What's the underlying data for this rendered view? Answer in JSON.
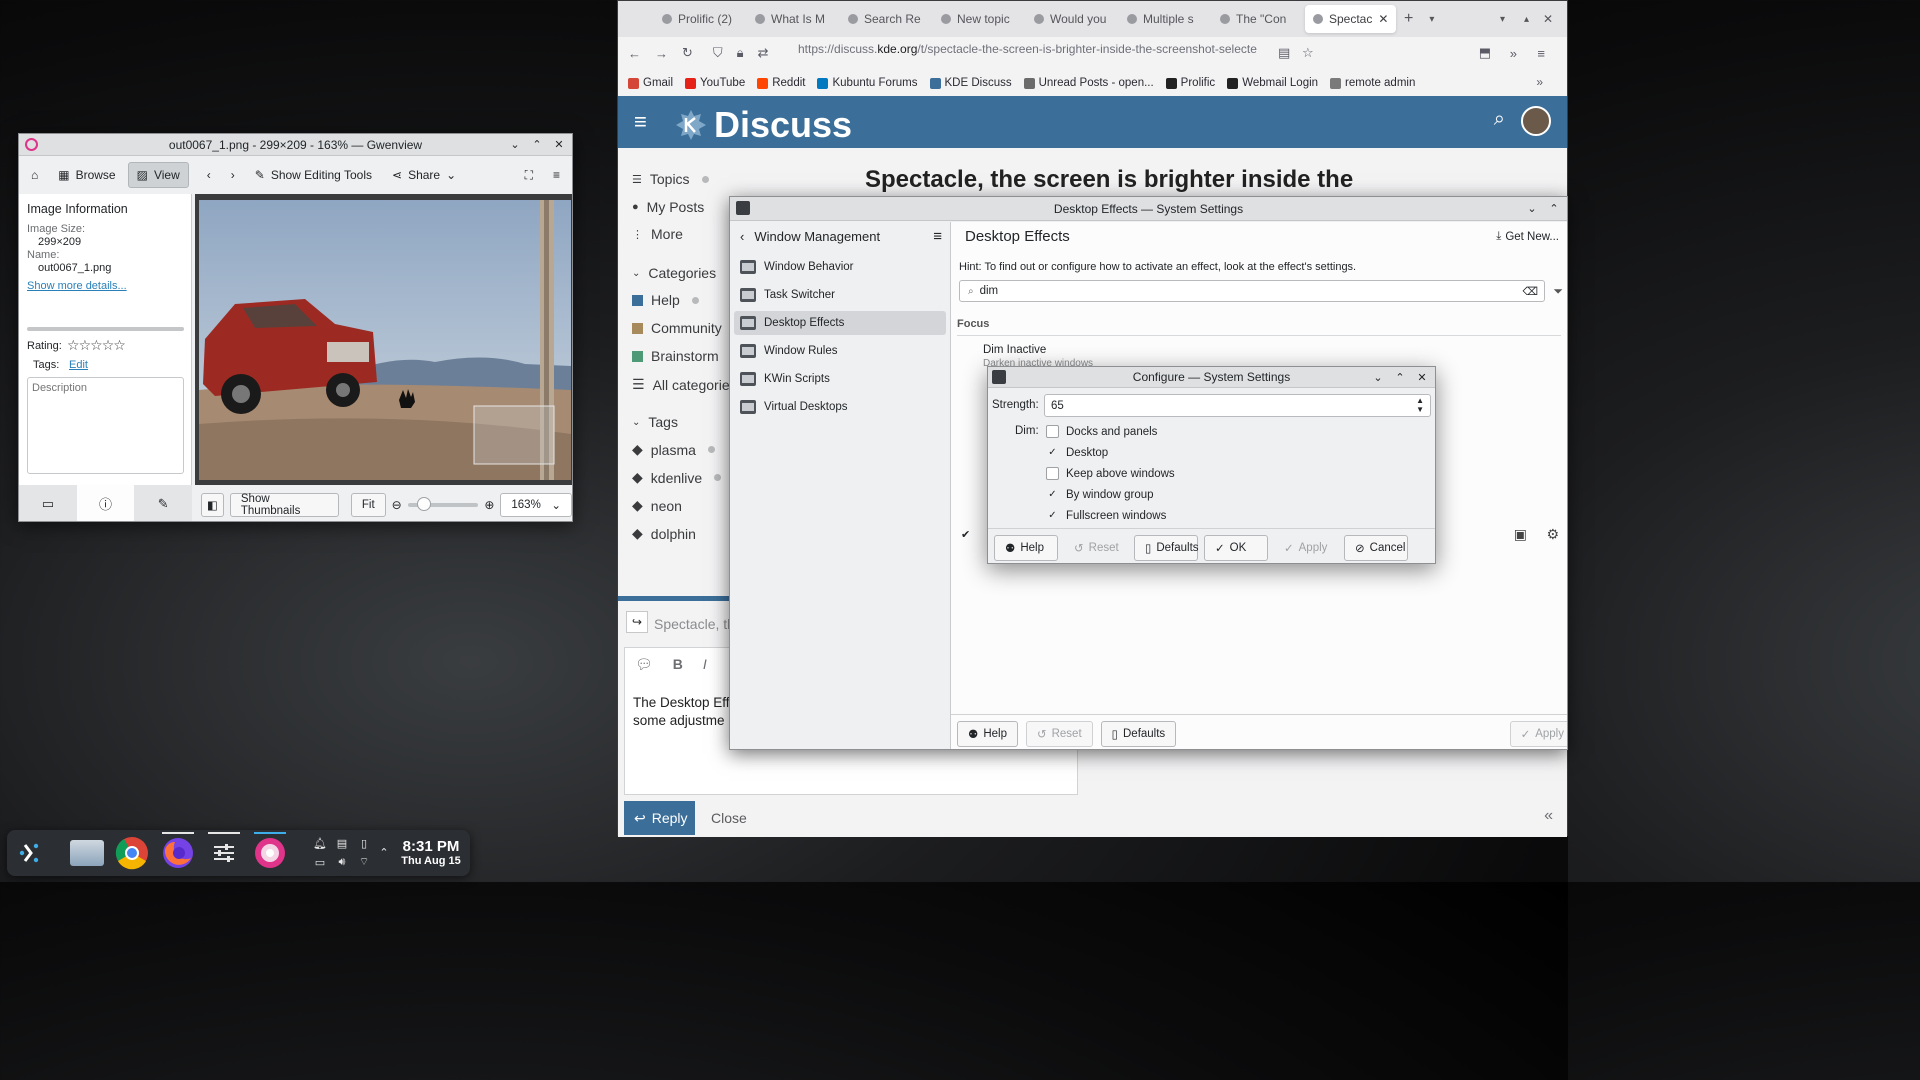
{
  "firefox": {
    "tabs": [
      {
        "label": "Prolific (2)"
      },
      {
        "label": "What Is M"
      },
      {
        "label": "Search Re"
      },
      {
        "label": "New topic"
      },
      {
        "label": "Would you"
      },
      {
        "label": "Multiple s"
      },
      {
        "label": "The \"Con"
      },
      {
        "label": "Spectac",
        "active": true
      }
    ],
    "url_prefix": "https://discuss.",
    "url_domain": "kde.org",
    "url_rest": "/t/spectacle-the-screen-is-brighter-inside-the-screenshot-selecte",
    "bookmarks": [
      {
        "label": "Gmail",
        "color": "#d44638"
      },
      {
        "label": "YouTube",
        "color": "#e62117"
      },
      {
        "label": "Reddit",
        "color": "#ff4500"
      },
      {
        "label": "Kubuntu Forums",
        "color": "#0079c1"
      },
      {
        "label": "KDE Discuss",
        "color": "#3b6e98"
      },
      {
        "label": "Unread Posts - open...",
        "color": "#6b6b6b"
      },
      {
        "label": "Prolific",
        "color": "#222"
      },
      {
        "label": "Webmail Login",
        "color": "#222"
      },
      {
        "label": "remote admin",
        "color": "#7a7a7a"
      }
    ]
  },
  "discuss": {
    "logo_text": "Discuss",
    "topic_title": "Spectacle, the screen is brighter inside the",
    "sidebar": {
      "topics": "Topics",
      "my_posts": "My Posts",
      "more": "More",
      "categories_header": "Categories",
      "categories": [
        {
          "label": "Help",
          "color": "#3b6e98"
        },
        {
          "label": "Community",
          "color": "#a78a5c"
        },
        {
          "label": "Brainstorm",
          "color": "#4e9a77"
        },
        {
          "label": "All categories"
        }
      ],
      "tags_header": "Tags",
      "tags": [
        "plasma",
        "kdenlive",
        "neon",
        "dolphin"
      ]
    },
    "composer": {
      "reply_title": "Spectacle, th",
      "body_line1": "The Desktop Eff",
      "body_line2": "some adjustme",
      "reply_button": "Reply",
      "close_button": "Close"
    }
  },
  "system_settings": {
    "title": "Desktop Effects — System Settings",
    "nav_title": "Window Management",
    "page_title": "Desktop Effects",
    "get_new": "Get New...",
    "hint": "Hint: To find out or configure how to activate an effect, look at the effect's settings.",
    "search_value": "dim",
    "section": "Focus",
    "effect_name": "Dim Inactive",
    "effect_desc": "Darken inactive windows",
    "sidebar_items": [
      {
        "label": "Window Behavior"
      },
      {
        "label": "Task Switcher"
      },
      {
        "label": "Desktop Effects",
        "selected": true
      },
      {
        "label": "Window Rules"
      },
      {
        "label": "KWin Scripts"
      },
      {
        "label": "Virtual Desktops"
      }
    ],
    "footer": {
      "help": "Help",
      "reset": "Reset",
      "defaults": "Defaults",
      "apply": "Apply"
    }
  },
  "configure_dialog": {
    "title": "Configure — System Settings",
    "strength_label": "Strength:",
    "strength_value": "65",
    "dim_label": "Dim:",
    "options": [
      {
        "label": "Docks and panels",
        "checked": false
      },
      {
        "label": "Desktop",
        "checked": true
      },
      {
        "label": "Keep above windows",
        "checked": false
      },
      {
        "label": "By window group",
        "checked": true
      },
      {
        "label": "Fullscreen windows",
        "checked": true
      }
    ],
    "buttons": {
      "help": "Help",
      "reset": "Reset",
      "defaults": "Defaults",
      "ok": "OK",
      "apply": "Apply",
      "cancel": "Cancel"
    }
  },
  "gwenview": {
    "title": "out0067_1.png - 299×209 - 163% — Gwenview",
    "toolbar": {
      "browse": "Browse",
      "view": "View",
      "editing_tools": "Show Editing Tools",
      "share": "Share"
    },
    "info": {
      "header": "Image Information",
      "size_label": "Image Size:",
      "size_value": "299×209",
      "name_label": "Name:",
      "name_value": "out0067_1.png",
      "more_details": "Show more details...",
      "rating_label": "Rating:",
      "tags_label": "Tags:",
      "tags_edit": "Edit",
      "description_placeholder": "Description"
    },
    "bottom": {
      "show_thumbnails": "Show Thumbnails",
      "fit": "Fit",
      "zoom_value": "163%",
      "zoom_slider": 0.15
    }
  },
  "taskbar": {
    "time": "8:31 PM",
    "date": "Thu Aug 15"
  }
}
